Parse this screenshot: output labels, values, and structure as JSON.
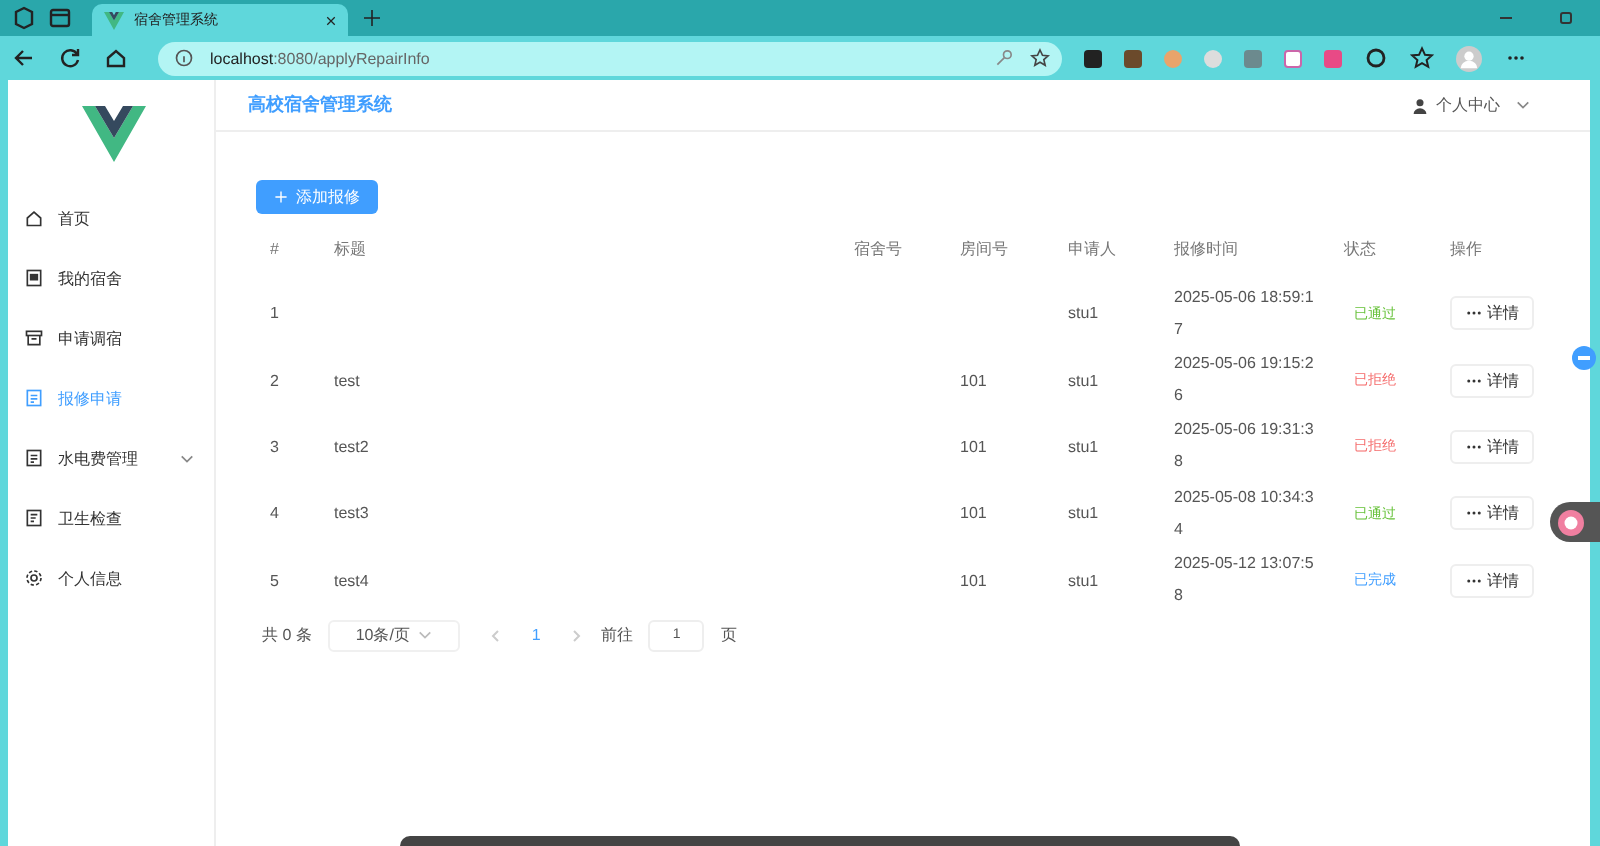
{
  "browser": {
    "tab_title": "宿舍管理系统",
    "url_host": "localhost",
    "url_path": ":8080/applyRepairInfo"
  },
  "app": {
    "title": "高校宿舍管理系统",
    "user_menu": "个人中心"
  },
  "sidebar": {
    "items": [
      {
        "label": "首页",
        "selected": false
      },
      {
        "label": "我的宿舍",
        "selected": false
      },
      {
        "label": "申请调宿",
        "selected": false
      },
      {
        "label": "报修申请",
        "selected": true
      },
      {
        "label": "水电费管理",
        "selected": false,
        "expanded": false
      },
      {
        "label": "卫生检查",
        "selected": false
      },
      {
        "label": "个人信息",
        "selected": false
      }
    ]
  },
  "add_button": "添加报修",
  "table": {
    "columns": [
      "#",
      "标题",
      "宿舍号",
      "房间号",
      "申请人",
      "报修时间",
      "状态",
      "操作"
    ],
    "rows": [
      {
        "no": "1",
        "title": "",
        "dorm": "",
        "room": "",
        "applicant": "stu1",
        "time": "2025-05-06 18:59:17",
        "status": {
          "label": "已通过",
          "kind": "passed"
        },
        "action": "详情"
      },
      {
        "no": "2",
        "title": "test",
        "dorm": "",
        "room": "101",
        "applicant": "stu1",
        "time": "2025-05-06 19:15:26",
        "status": {
          "label": "已拒绝",
          "kind": "rejected"
        },
        "action": "详情"
      },
      {
        "no": "3",
        "title": "test2",
        "dorm": "",
        "room": "101",
        "applicant": "stu1",
        "time": "2025-05-06 19:31:38",
        "status": {
          "label": "已拒绝",
          "kind": "rejected"
        },
        "action": "详情"
      },
      {
        "no": "4",
        "title": "test3",
        "dorm": "",
        "room": "101",
        "applicant": "stu1",
        "time": "2025-05-08 10:34:34",
        "status": {
          "label": "已通过",
          "kind": "passed"
        },
        "action": "详情"
      },
      {
        "no": "5",
        "title": "test4",
        "dorm": "",
        "room": "101",
        "applicant": "stu1",
        "time": "2025-05-12 13:07:58",
        "status": {
          "label": "已完成",
          "kind": "done"
        },
        "action": "详情"
      }
    ]
  },
  "pagination": {
    "total": "共 0 条",
    "page_size": "10条/页",
    "current_page": "1",
    "goto_label": "前往",
    "goto_value": "1",
    "page_unit": "页"
  }
}
